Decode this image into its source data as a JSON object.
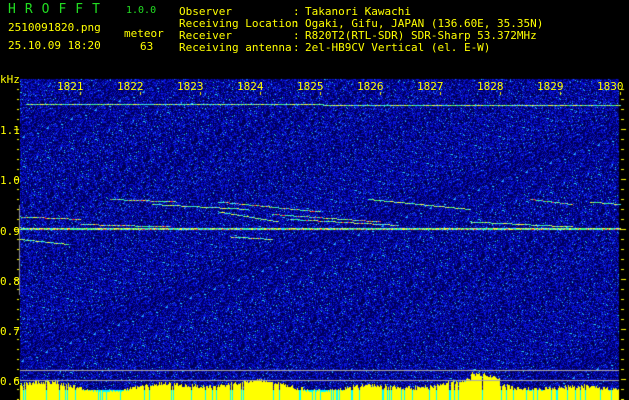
{
  "header": {
    "app_name": "HROFFT",
    "version": "1.0.0",
    "filename": "2510091820.png",
    "datetime": "25.10.09 18:20",
    "meteor_label": "meteor",
    "meteor_count": "63",
    "info": [
      {
        "label": "Observer",
        "value": "Takanori Kawachi"
      },
      {
        "label": "Receiving Location",
        "value": "Ogaki, Gifu, JAPAN (136.60E, 35.35N)"
      },
      {
        "label": "Receiver",
        "value": "R820T2(RTL-SDR) SDR-Sharp 53.372MHz"
      },
      {
        "label": "Receiving antenna",
        "value": "2el-HB9CV Vertical (el. E-W)"
      }
    ]
  },
  "spectrogram": {
    "y_unit": "kHz",
    "y_ticks": [
      "1.1",
      "1.0",
      "0.9",
      "0.8",
      "0.7",
      "0.6"
    ],
    "x_ticks": [
      "1821",
      "1822",
      "1823",
      "1824",
      "1825",
      "1826",
      "1827",
      "1828",
      "1829",
      "1830"
    ],
    "colors": {
      "text": "#ffff00",
      "title": "#22dd22",
      "background": "#000000",
      "noise": "#0a14b4",
      "histogram": "#ffff00",
      "baseline": "#00ffff"
    }
  }
}
